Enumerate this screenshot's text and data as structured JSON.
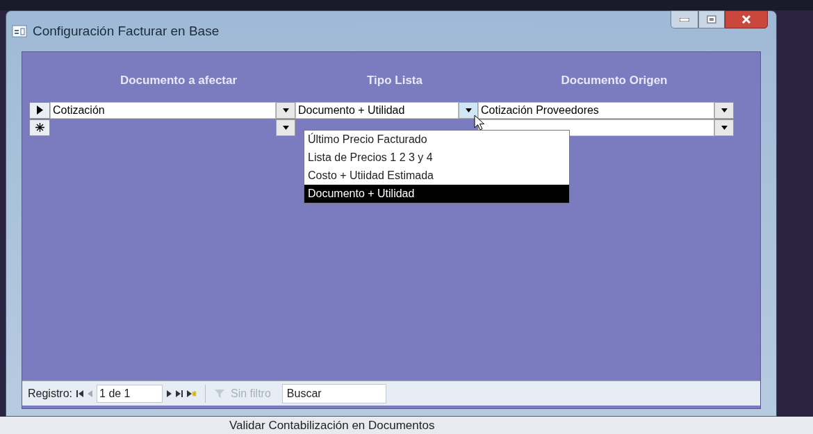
{
  "window": {
    "title": "Configuración Facturar en Base"
  },
  "columns": [
    "Documento a afectar",
    "Tipo Lista",
    "Documento Origen"
  ],
  "rows": [
    {
      "kind": "current",
      "cells": [
        "Cotización",
        "Documento + Utilidad",
        "Cotización Proveedores"
      ]
    },
    {
      "kind": "new",
      "cells": [
        "",
        "",
        ""
      ]
    }
  ],
  "dropdown": {
    "items": [
      {
        "label": "Último Precio Facturado",
        "selected": false
      },
      {
        "label": "Lista de Precios 1 2 3 y 4",
        "selected": false
      },
      {
        "label": "Costo + Utiidad Estimada",
        "selected": false
      },
      {
        "label": "Documento + Utilidad",
        "selected": true
      }
    ]
  },
  "navigation": {
    "label": "Registro:",
    "position": "1 de 1",
    "filter": "Sin filtro",
    "search_placeholder": "Buscar"
  },
  "background_text": "Validar Contabilización en Documentos"
}
